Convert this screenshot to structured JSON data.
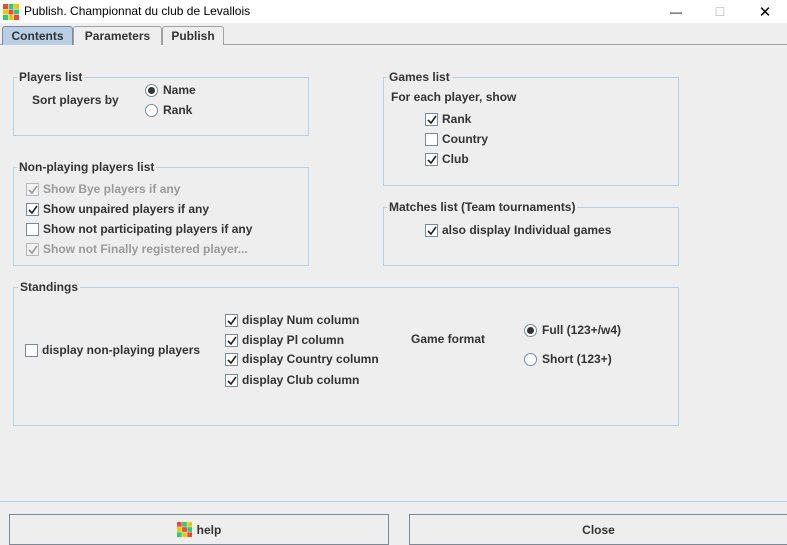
{
  "window": {
    "title": "Publish. Championnat du club de Levallois",
    "minimize_icon": "—",
    "maximize_icon": "☐",
    "close_icon": "✕"
  },
  "tabs": [
    {
      "label": "Contents",
      "selected": true
    },
    {
      "label": "Parameters",
      "selected": false
    },
    {
      "label": "Publish",
      "selected": false
    }
  ],
  "players_list": {
    "legend": "Players list",
    "sort_label": "Sort players by",
    "options": [
      {
        "label": "Name",
        "selected": true
      },
      {
        "label": "Rank",
        "selected": false
      }
    ]
  },
  "games_list": {
    "legend": "Games list",
    "subtitle": "For each player, show",
    "items": [
      {
        "label": "Rank",
        "checked": true
      },
      {
        "label": "Country",
        "checked": false
      },
      {
        "label": "Club",
        "checked": true
      }
    ]
  },
  "non_playing": {
    "legend": "Non-playing players list",
    "items": [
      {
        "label": "Show Bye players if any",
        "checked": true,
        "enabled": false
      },
      {
        "label": "Show unpaired players if any",
        "checked": true,
        "enabled": true
      },
      {
        "label": "Show not participating players if any",
        "checked": false,
        "enabled": true
      },
      {
        "label": "Show not Finally registered player...",
        "checked": true,
        "enabled": false
      }
    ]
  },
  "matches_list": {
    "legend": "Matches list (Team tournaments)",
    "item": {
      "label": "also display Individual games",
      "checked": true
    }
  },
  "standings": {
    "legend": "Standings",
    "non_playing": {
      "label": "display non-playing players",
      "checked": false
    },
    "columns": [
      {
        "label": "display Num column",
        "checked": true
      },
      {
        "label": "display Pl column",
        "checked": true
      },
      {
        "label": "display Country column",
        "checked": true
      },
      {
        "label": "display Club column",
        "checked": true
      }
    ],
    "game_format_label": "Game format",
    "formats": [
      {
        "label": "Full (123+/w4)",
        "selected": true
      },
      {
        "label": "Short (123+)",
        "selected": false
      }
    ]
  },
  "buttons": {
    "help": "help",
    "close": "Close"
  },
  "colors": {
    "background": "#eeeeee",
    "selected_tab": "#b8cfe5",
    "group_border": "#b8cfe5",
    "text": "#333333",
    "disabled_text": "#9a9a9a"
  },
  "icons": {
    "app": "app-logo-icon",
    "help": "app-logo-icon",
    "check": "checkmark-icon"
  }
}
